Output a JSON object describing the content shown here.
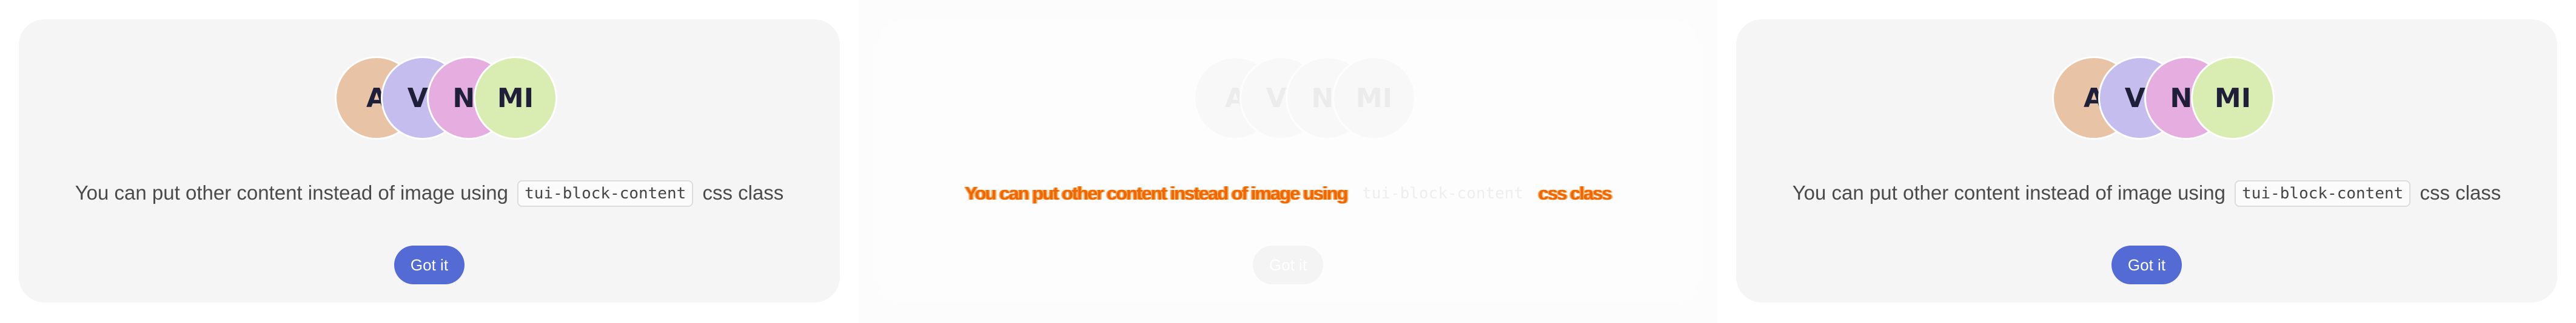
{
  "avatars": [
    {
      "initials": "A",
      "color": "#e8c3a6"
    },
    {
      "initials": "VI",
      "color": "#c5bdee"
    },
    {
      "initials": "NI",
      "color": "#e6aee0"
    },
    {
      "initials": "MI",
      "color": "#d9ecb2"
    }
  ],
  "message": {
    "before": "You can put other content instead of image using",
    "code": "tui-block-content",
    "after": "css class"
  },
  "button": {
    "label": "Got it",
    "color": "#546ad4"
  }
}
